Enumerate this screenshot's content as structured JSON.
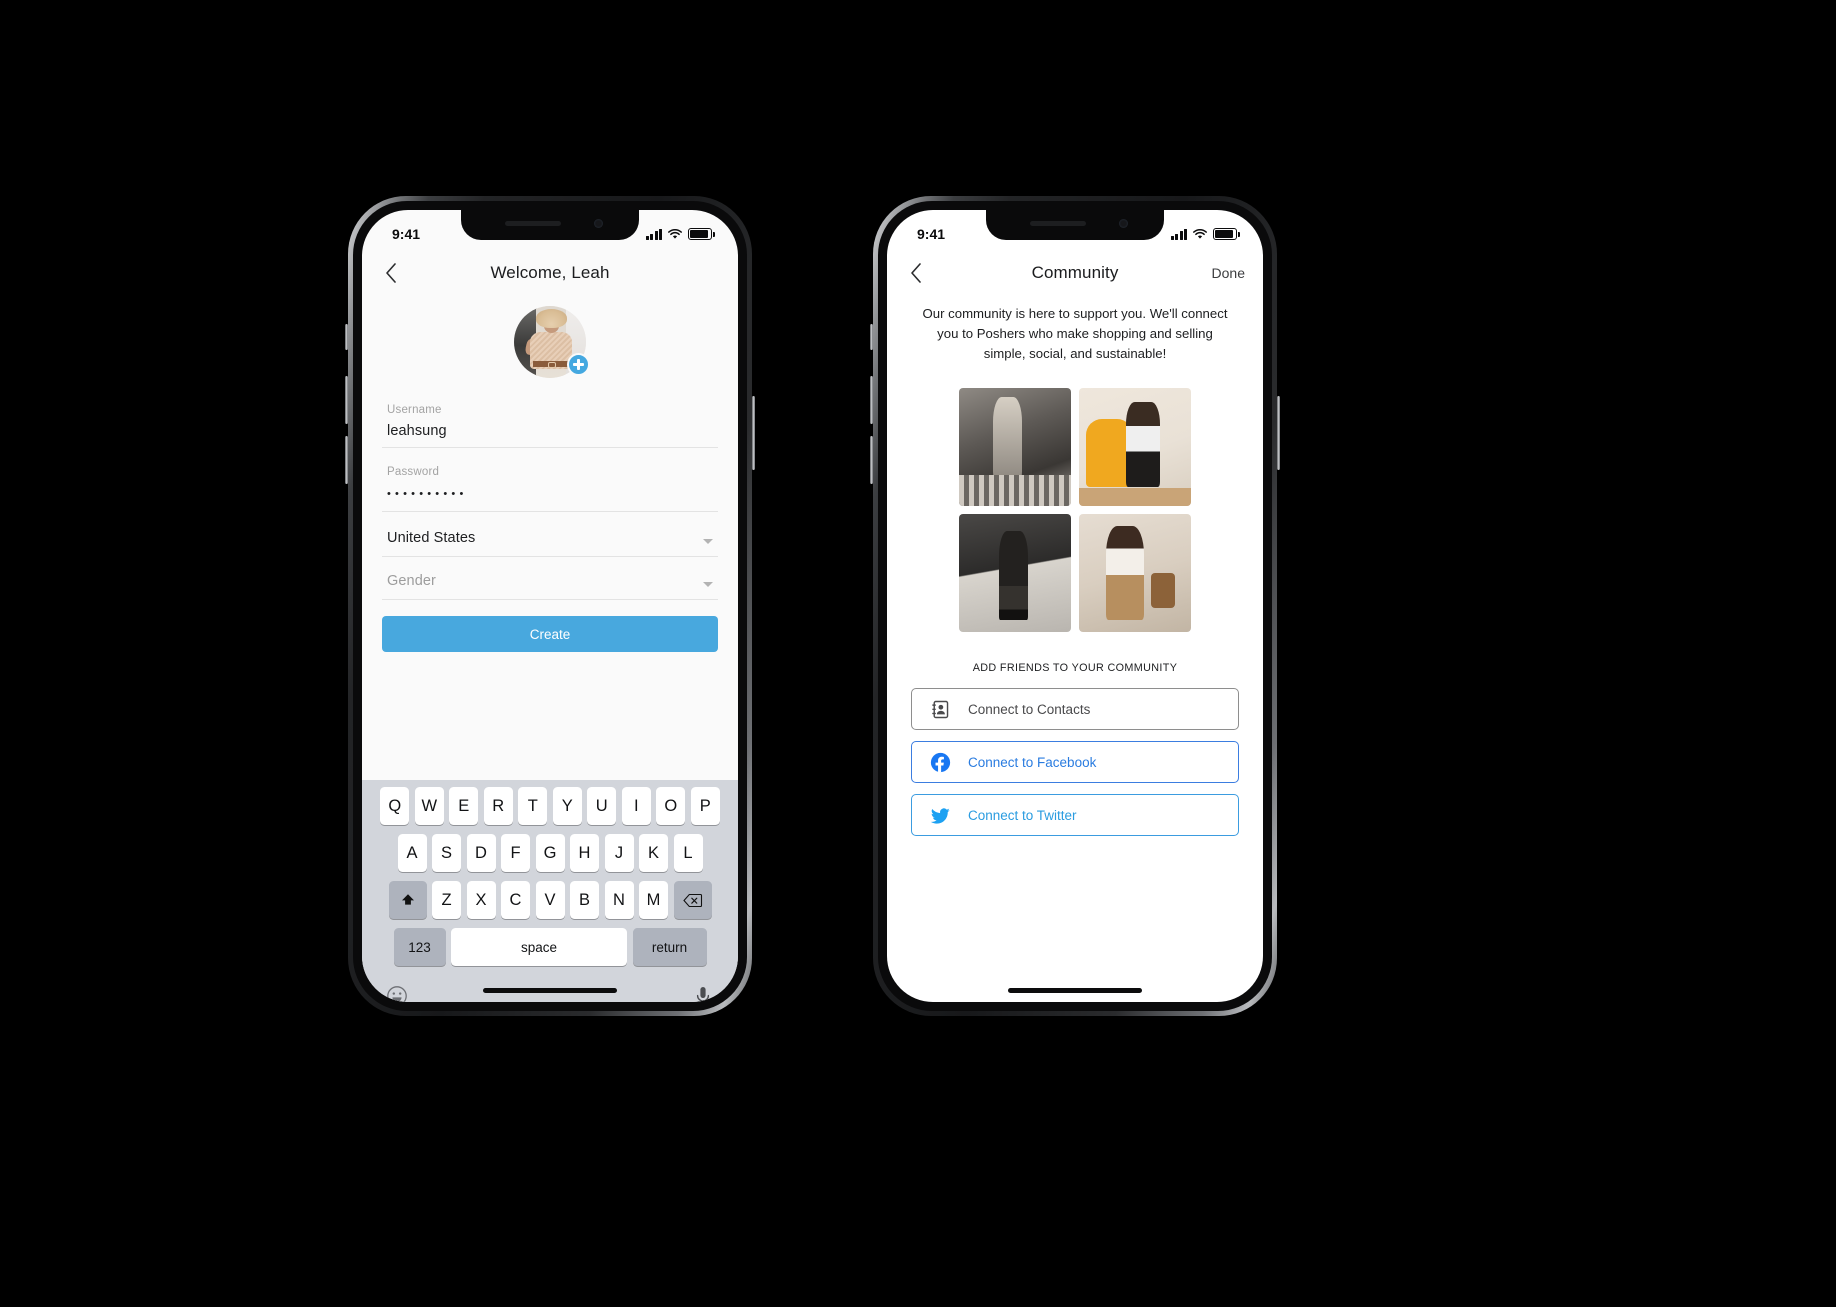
{
  "phones": [
    {
      "id": "signup",
      "status": {
        "time": "9:41"
      },
      "nav": {
        "title": "Welcome, Leah",
        "back_icon": "chevron-left-icon",
        "right_label": ""
      },
      "avatar": {
        "add_icon": "plus-icon"
      },
      "form": {
        "fields": [
          {
            "label": "Username",
            "value": "leahsung",
            "type": "text"
          },
          {
            "label": "Password",
            "value": "••••••••••",
            "type": "password"
          },
          {
            "label": "",
            "value": "United States",
            "type": "select",
            "placeholder": "Country"
          },
          {
            "label": "",
            "value": "Gender",
            "type": "select",
            "placeholder": "Gender"
          }
        ],
        "submit_label": "Create",
        "submit_color": "#48a8de"
      },
      "keyboard": {
        "row1": [
          "Q",
          "W",
          "E",
          "R",
          "T",
          "Y",
          "U",
          "I",
          "O",
          "P"
        ],
        "row2": [
          "A",
          "S",
          "D",
          "F",
          "G",
          "H",
          "J",
          "K",
          "L"
        ],
        "row3": [
          "Z",
          "X",
          "C",
          "V",
          "B",
          "N",
          "M"
        ],
        "shift_icon": "shift-up-icon",
        "backspace_icon": "backspace-icon",
        "numeric_label": "123",
        "space_label": "space",
        "return_label": "return",
        "emoji_icon": "emoji-smiley-icon",
        "mic_icon": "microphone-icon"
      }
    },
    {
      "id": "community",
      "status": {
        "time": "9:41"
      },
      "nav": {
        "title": "Community",
        "back_icon": "chevron-left-icon",
        "right_label": "Done"
      },
      "intro": "Our community is here to support you. We'll connect you to Poshers who make shopping and selling simple, social, and sustainable!",
      "photos": [
        {
          "alt": "person-in-hallway-photo"
        },
        {
          "alt": "person-with-yellow-chair-photo"
        },
        {
          "alt": "person-in-black-outfit-photo"
        },
        {
          "alt": "person-with-bag-photo"
        }
      ],
      "add_friends_label": "ADD FRIENDS TO YOUR COMMUNITY",
      "connect_buttons": [
        {
          "label": "Connect to Contacts",
          "icon": "contacts-icon",
          "color": "#4a4a4c"
        },
        {
          "label": "Connect to Facebook",
          "icon": "facebook-icon",
          "color": "#2a7ce0"
        },
        {
          "label": "Connect to Twitter",
          "icon": "twitter-icon",
          "color": "#2a9ce0"
        }
      ]
    }
  ]
}
